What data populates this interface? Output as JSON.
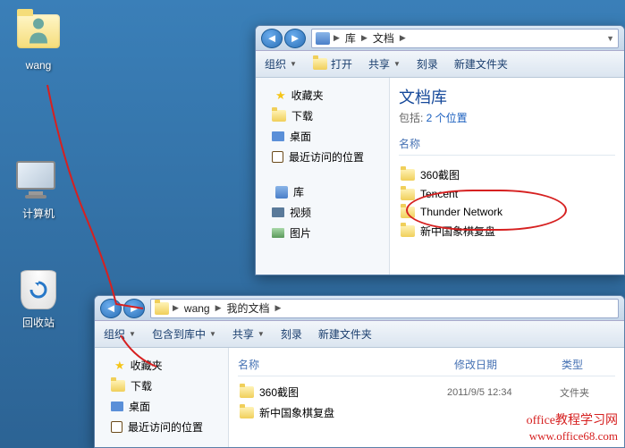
{
  "desktop": {
    "icons": [
      {
        "name": "wang"
      },
      {
        "name": "计算机"
      },
      {
        "name": "回收站"
      }
    ]
  },
  "window1": {
    "breadcrumb": {
      "root_icon": "library",
      "items": [
        "库",
        "文档"
      ]
    },
    "toolbar": {
      "organize": "组织",
      "open": "打开",
      "share": "共享",
      "burn": "刻录",
      "new_folder": "新建文件夹"
    },
    "sidebar": {
      "favorites": {
        "label": "收藏夹",
        "items": [
          {
            "label": "下载",
            "icon": "download"
          },
          {
            "label": "桌面",
            "icon": "desktop"
          },
          {
            "label": "最近访问的位置",
            "icon": "recent"
          }
        ]
      },
      "libraries": {
        "label": "库",
        "items": [
          {
            "label": "视频",
            "icon": "video"
          },
          {
            "label": "图片",
            "icon": "picture"
          }
        ]
      }
    },
    "content": {
      "library_title": "文档库",
      "library_sub_prefix": "包括: ",
      "library_sub_link": "2 个位置",
      "col_name": "名称",
      "items": [
        {
          "name": "360截图"
        },
        {
          "name": "Tencent"
        },
        {
          "name": "Thunder Network"
        },
        {
          "name": "新中国象棋复盘"
        }
      ]
    }
  },
  "window2": {
    "breadcrumb": {
      "root_icon": "folder-user",
      "items": [
        "wang",
        "我的文档"
      ]
    },
    "toolbar": {
      "organize": "组织",
      "include_in_lib": "包含到库中",
      "share": "共享",
      "burn": "刻录",
      "new_folder": "新建文件夹"
    },
    "sidebar": {
      "favorites": {
        "label": "收藏夹",
        "items": [
          {
            "label": "下载",
            "icon": "download"
          },
          {
            "label": "桌面",
            "icon": "desktop"
          },
          {
            "label": "最近访问的位置",
            "icon": "recent"
          }
        ]
      }
    },
    "content": {
      "col_name": "名称",
      "col_date": "修改日期",
      "col_type": "类型",
      "items": [
        {
          "name": "360截图",
          "date": "2011/9/5 12:34",
          "type": "文件夹"
        },
        {
          "name": "新中国象棋复盘",
          "date": "",
          "type": ""
        }
      ]
    }
  },
  "watermark": {
    "line1": "office教程学习网",
    "line2": "www.office68.com"
  }
}
